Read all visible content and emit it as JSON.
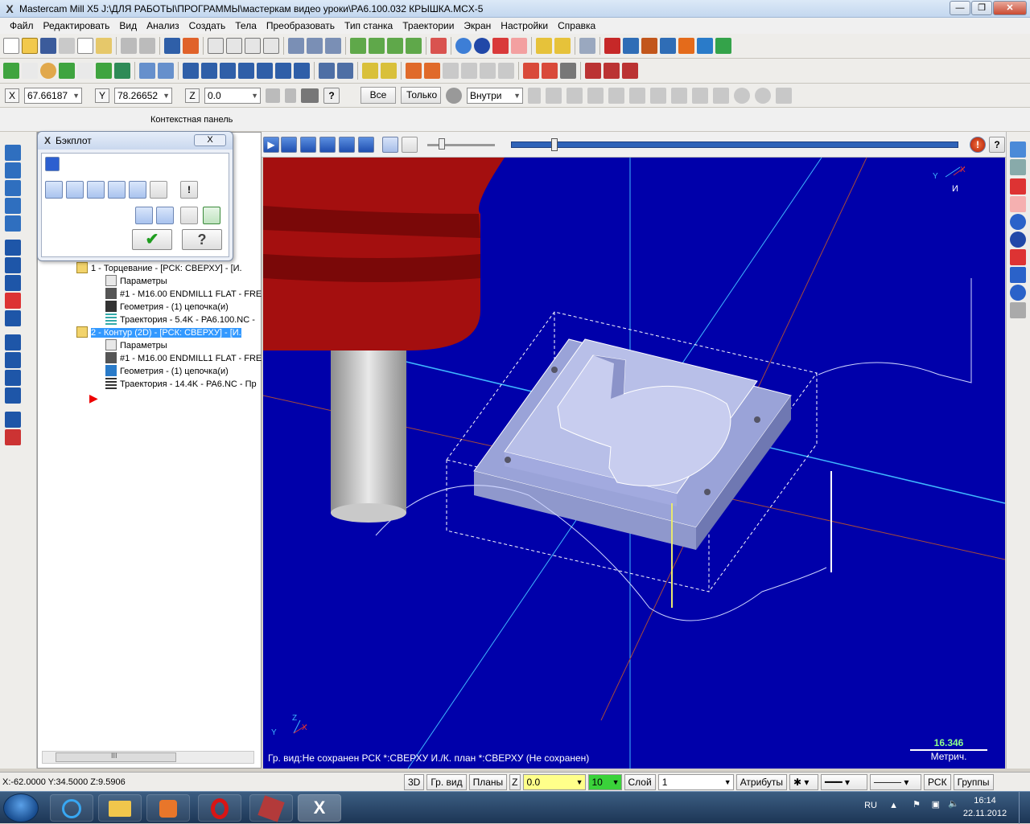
{
  "window": {
    "title": "Mastercam Mill X5  J:\\ДЛЯ РАБОТЫ\\ПРОГРАММЫ\\мастеркам видео уроки\\РА6.100.032 КРЫШКА.MCX-5"
  },
  "menu": [
    "Файл",
    "Редактировать",
    "Вид",
    "Анализ",
    "Создать",
    "Тела",
    "Преобразовать",
    "Тип станка",
    "Траектории",
    "Экран",
    "Настройки",
    "Справка"
  ],
  "coords": {
    "x_label": "X",
    "x_value": "67.66187",
    "y_label": "Y",
    "y_value": "78.26652",
    "z_label": "Z",
    "z_value": "0.0",
    "all_button": "Все",
    "only_button": "Только",
    "inside_select": "Внутри"
  },
  "context_panel": {
    "caption": "Контекстная панель"
  },
  "backplot": {
    "title": "Бэкплот",
    "close": "X"
  },
  "ops": {
    "op1": "1 - Торцевание - [РСК: СВЕРХУ] - [И.",
    "op1_params": "Параметры",
    "op1_tool": "#1 - M16.00 ENDMILL1 FLAT - FRE",
    "op1_geom": "Геометрия - (1) цепочка(и)",
    "op1_path": "Траектория - 5.4K - PA6.100.NC -",
    "op2": "2 - Контур (2D) - [РСК: СВЕРХУ] - [И.",
    "op2_params": "Параметры",
    "op2_tool": "#1 - M16.00 ENDMILL1 FLAT - FRE",
    "op2_geom": "Геометрия - (1) цепочка(и)",
    "op2_path": "Траектория - 14.4K - PA6.NC - Пр"
  },
  "scroll": {
    "grip": "III"
  },
  "view": {
    "status": "Гр. вид:Не сохранен  РСК *:СВЕРХУ  И./К. план *:СВЕРХУ (Не сохранен)",
    "scale_value": "16.346",
    "scale_unit": "Метрич.",
    "gnomon_y": "Y",
    "gnomon_x": "X",
    "gnomon_label": "И",
    "origin_y": "Y",
    "origin_z": "Z",
    "origin_x": "X"
  },
  "statusbar": {
    "coords": "X:-62.0000  Y:34.5000  Z:9.5906",
    "btn_3d": "3D",
    "btn_grview": "Гр. вид",
    "btn_planes": "Планы",
    "z_label": "Z",
    "z_value": "0.0",
    "color_value": "10",
    "layer_label": "Слой",
    "layer_value": "1",
    "attrs": "Атрибуты",
    "wcs": "РСК",
    "groups": "Группы"
  },
  "tray": {
    "lang": "RU",
    "time": "16:14",
    "date": "22.11.2012"
  },
  "colors": {
    "viewport": "#0000aa",
    "tool_holder": "#b01010",
    "part": "#b8bfe8",
    "accent": "#3399ff"
  }
}
